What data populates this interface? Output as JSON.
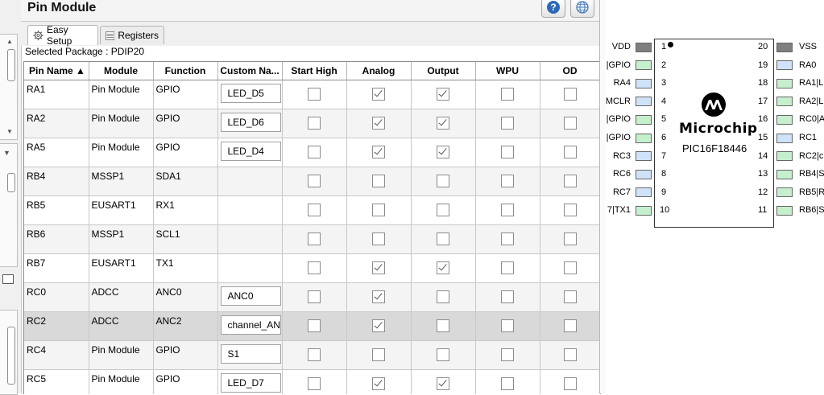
{
  "header": {
    "title": "Pin Module",
    "help_glyph": "?"
  },
  "tabs": [
    {
      "label": "Easy Setup",
      "icon": "gear-icon",
      "active": true
    },
    {
      "label": "Registers",
      "icon": "list-icon",
      "active": false
    }
  ],
  "package": {
    "text": "Selected Package : PDIP20"
  },
  "table": {
    "columns": [
      {
        "label": "Pin Name ▲",
        "sorted": "ascending"
      },
      {
        "label": "Module"
      },
      {
        "label": "Function"
      },
      {
        "label": "Custom Na..."
      },
      {
        "label": "Start High"
      },
      {
        "label": "Analog"
      },
      {
        "label": "Output"
      },
      {
        "label": "WPU"
      },
      {
        "label": "OD"
      }
    ],
    "rows": [
      {
        "pin": "RA1",
        "module": "Pin Module",
        "function": "GPIO",
        "custom_name": "LED_D5",
        "start_high": false,
        "analog": true,
        "output": true,
        "wpu": false,
        "od": false
      },
      {
        "pin": "RA2",
        "module": "Pin Module",
        "function": "GPIO",
        "custom_name": "LED_D6",
        "start_high": false,
        "analog": true,
        "output": true,
        "wpu": false,
        "od": false
      },
      {
        "pin": "RA5",
        "module": "Pin Module",
        "function": "GPIO",
        "custom_name": "LED_D4",
        "start_high": false,
        "analog": true,
        "output": true,
        "wpu": false,
        "od": false
      },
      {
        "pin": "RB4",
        "module": "MSSP1",
        "function": "SDA1",
        "custom_name": null,
        "start_high": false,
        "analog": false,
        "output": false,
        "wpu": false,
        "od": false
      },
      {
        "pin": "RB5",
        "module": "EUSART1",
        "function": "RX1",
        "custom_name": null,
        "start_high": false,
        "analog": false,
        "output": false,
        "wpu": false,
        "od": false
      },
      {
        "pin": "RB6",
        "module": "MSSP1",
        "function": "SCL1",
        "custom_name": null,
        "start_high": false,
        "analog": false,
        "output": false,
        "wpu": false,
        "od": false
      },
      {
        "pin": "RB7",
        "module": "EUSART1",
        "function": "TX1",
        "custom_name": null,
        "start_high": false,
        "analog": true,
        "output": true,
        "wpu": false,
        "od": false
      },
      {
        "pin": "RC0",
        "module": "ADCC",
        "function": "ANC0",
        "custom_name": "ANC0",
        "start_high": false,
        "analog": true,
        "output": false,
        "wpu": false,
        "od": false
      },
      {
        "pin": "RC2",
        "module": "ADCC",
        "function": "ANC2",
        "custom_name": "channel_AN",
        "start_high": false,
        "analog": true,
        "output": false,
        "wpu": false,
        "od": false,
        "selected": true
      },
      {
        "pin": "RC4",
        "module": "Pin Module",
        "function": "GPIO",
        "custom_name": "S1",
        "start_high": false,
        "analog": false,
        "output": false,
        "wpu": false,
        "od": false
      },
      {
        "pin": "RC5",
        "module": "Pin Module",
        "function": "GPIO",
        "custom_name": "LED_D7",
        "start_high": false,
        "analog": true,
        "output": true,
        "wpu": false,
        "od": false
      }
    ]
  },
  "chip": {
    "logo_text": "Microchip",
    "part": "PIC16F18446",
    "left_pins": [
      {
        "num": "1",
        "label": "VDD",
        "state": "power"
      },
      {
        "num": "2",
        "label": "|GPIO",
        "state": "assigned"
      },
      {
        "num": "3",
        "label": "RA4",
        "state": "free"
      },
      {
        "num": "4",
        "label": "MCLR",
        "state": "free"
      },
      {
        "num": "5",
        "label": "|GPIO",
        "state": "assigned"
      },
      {
        "num": "6",
        "label": "|GPIO",
        "state": "assigned"
      },
      {
        "num": "7",
        "label": "RC3",
        "state": "free"
      },
      {
        "num": "8",
        "label": "RC6",
        "state": "free"
      },
      {
        "num": "9",
        "label": "RC7",
        "state": "free"
      },
      {
        "num": "10",
        "label": "7|TX1",
        "state": "assigned"
      }
    ],
    "right_pins": [
      {
        "num": "20",
        "label": "VSS",
        "state": "power"
      },
      {
        "num": "19",
        "label": "RA0",
        "state": "free"
      },
      {
        "num": "18",
        "label": "RA1|L",
        "state": "assigned"
      },
      {
        "num": "17",
        "label": "RA2|L",
        "state": "assigned"
      },
      {
        "num": "16",
        "label": "RC0|A",
        "state": "assigned"
      },
      {
        "num": "15",
        "label": "RC1",
        "state": "free"
      },
      {
        "num": "14",
        "label": "RC2|c",
        "state": "assigned"
      },
      {
        "num": "13",
        "label": "RB4|S",
        "state": "assigned"
      },
      {
        "num": "12",
        "label": "RB5|R",
        "state": "assigned"
      },
      {
        "num": "11",
        "label": "RB6|S",
        "state": "assigned"
      }
    ]
  },
  "colors": {
    "pin_power": "#7f7f7f",
    "pin_assigned": "#c6efce",
    "pin_free": "#cfe2f7",
    "selected_row": "#d9d9d9",
    "help_button": "#2c67b8"
  }
}
